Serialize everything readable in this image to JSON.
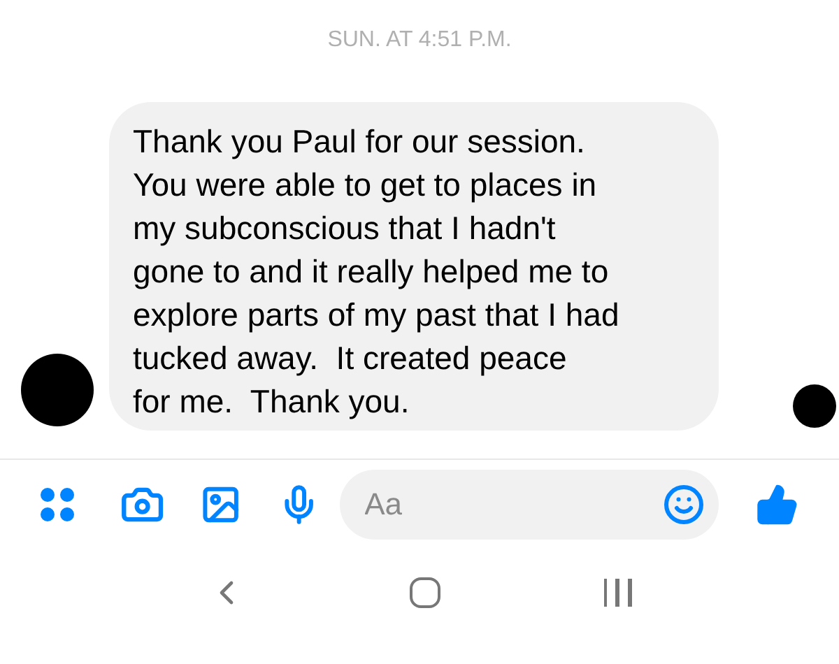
{
  "timestamp": "SUN. AT 4:51 P.M.",
  "message": {
    "text": "Thank you Paul for our session.\nYou were able to get to places in\nmy subconscious that I hadn't\ngone to and it really helped me to\nexplore parts of my past that I had\ntucked away.  It created peace\nfor me.  Thank you."
  },
  "composer": {
    "placeholder": "Aa"
  }
}
